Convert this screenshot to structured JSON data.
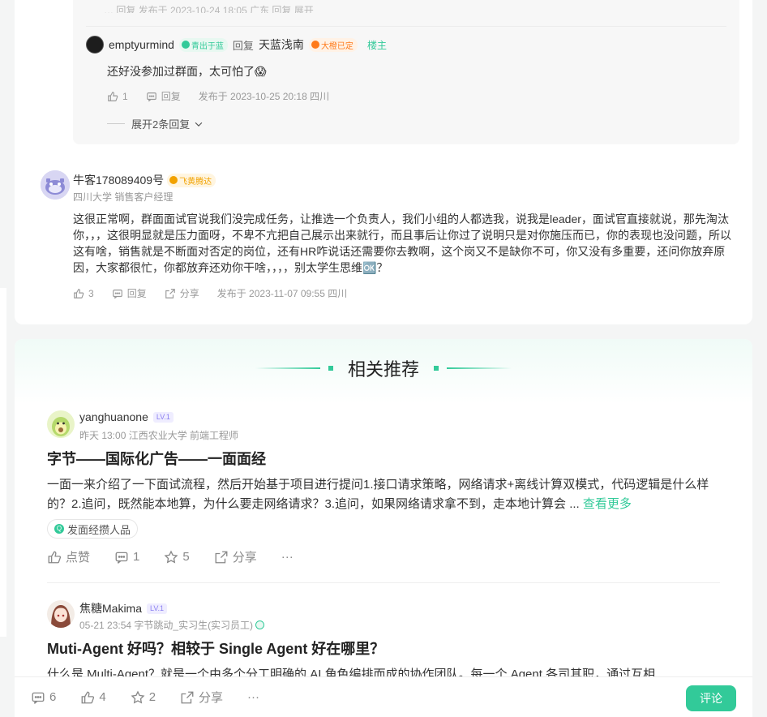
{
  "top_reply_cutoff": "… 回复 发布于 2023-10-24 18:05 广东 回复 展开",
  "reply": {
    "username": "emptyurmind",
    "badge": "青出于蓝",
    "reply_label": "回复",
    "target_user": "天蓝浅南",
    "target_badge": "大橙已定",
    "owner_tag": "楼主",
    "text": "还好没参加过群面，太可怕了😱",
    "likes": "1",
    "reply_action": "回复",
    "time": "发布于 2023-10-25 20:18 四川",
    "expand": "展开2条回复"
  },
  "comment": {
    "username": "牛客178089409号",
    "badge": "飞黄腾达",
    "subtitle": "四川大学 销售客户经理",
    "text": "这很正常啊，群面面试官说我们没完成任务，让推选一个负责人，我们小组的人都选我，说我是leader，面试官直接就说，那先淘汰你，，，这很明显就是压力面呀，不卑不亢把自己展示出来就行，而且事后让你过了说明只是对你施压而已，你的表现也没问题，所以这有啥，销售就是不断面对否定的岗位，还有HR咋说话还需要你去教啊，这个岗又不是缺你不可，你又没有多重要，还问你放弃原因，大家都很忙，你都放弃还劝你干啥，，，，别太学生思维🆗？",
    "likes": "3",
    "reply_action": "回复",
    "share_action": "分享",
    "time": "发布于 2023-11-07 09:55 四川"
  },
  "related": {
    "heading": "相关推荐",
    "posts": [
      {
        "username": "yanghuanone",
        "level": "LV.1",
        "subtitle": "昨天 13:00  江西农业大学 前端工程师",
        "title": "字节——国际化广告——一面面经",
        "text": "一面一来介绍了一下面试流程，然后开始基于项目进行提问1.接口请求策略，网络请求+离线计算双模式，代码逻辑是什么样的？2.追问，既然能本地算，为什么要走网络请求？3.追问，如果网络请求拿不到，走本地计算会 ...",
        "more": "查看更多",
        "tag": "发面经攒人品",
        "like_label": "点赞",
        "comments": "1",
        "stars": "5",
        "share_label": "分享",
        "more_icon": "···"
      },
      {
        "username": "焦糖Makima",
        "level": "LV.1",
        "subtitle": "05-21 23:54  字节跳动_实习生(实习员工)",
        "title": "Muti-Agent 好吗？相较于 Single Agent 好在哪里？",
        "text": "什么是 Multi-Agent？就是一个由多个分工明确的 AI 角色编排而成的协作团队。每一个 Agent 各司其职，通过互相"
      }
    ]
  },
  "bottom_bar": {
    "comments": "6",
    "likes": "4",
    "stars": "2",
    "share_label": "分享",
    "more_icon": "···",
    "comment_button": "评论"
  },
  "colors": {
    "accent": "#32ca99",
    "text": "#333333",
    "muted": "#999999",
    "background": "#f4f5f5"
  }
}
